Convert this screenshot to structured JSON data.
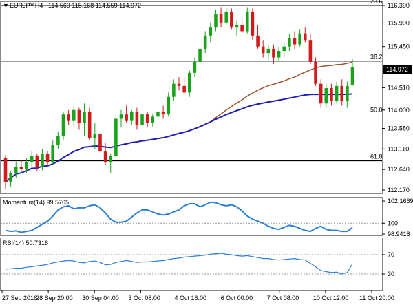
{
  "header": {
    "symbol": "EURJPY,H4",
    "ohlc": "114.569 115.168 114.559 114.972"
  },
  "main_panel": {
    "price_ticks": [
      "116.390",
      "115.990",
      "115.450",
      "114.510",
      "114.000",
      "113.580",
      "113.110",
      "112.640",
      "112.170"
    ],
    "current_price": "114.972",
    "fib_levels": [
      {
        "label": "23.6",
        "price": 116.39
      },
      {
        "label": "38.2",
        "price": 115.12
      },
      {
        "label": "50.0",
        "price": 113.91
      },
      {
        "label": "61.8",
        "price": 112.84
      }
    ]
  },
  "momentum_panel": {
    "title": "Momentum(14) 99.5765",
    "ticks": [
      "102.1669",
      "100",
      "98.9418"
    ]
  },
  "rsi_panel": {
    "title": "RSI(14) 50.7318",
    "ticks": [
      "70",
      "30"
    ]
  },
  "time_labels": [
    "27 Sep 2016",
    "28 Sep 20:00",
    "30 Sep 04:00",
    "3 Oct 08:00",
    "4 Oct 16:00",
    "6 Oct 00:00",
    "7 Oct 08:00",
    "10 Oct 12:00",
    "11 Oct 20:00"
  ],
  "colors": {
    "bull": "#1aa31a",
    "bear": "#d11a1a",
    "sma100": "#a0522d",
    "sma200": "#1f1fb3",
    "momentum": "#2b7fd4",
    "rsi": "#2b7fd4",
    "level": "#000000"
  },
  "chart_data": [
    {
      "type": "candlestick",
      "name": "EURJPY,H4",
      "ylim": [
        112.17,
        116.39
      ],
      "candles": [
        [
          112.9,
          112.97,
          112.2,
          112.35
        ],
        [
          112.35,
          112.6,
          112.25,
          112.55
        ],
        [
          112.55,
          112.8,
          112.45,
          112.7
        ],
        [
          112.7,
          112.85,
          112.6,
          112.65
        ],
        [
          112.65,
          112.9,
          112.55,
          112.8
        ],
        [
          112.8,
          113.05,
          112.7,
          112.95
        ],
        [
          112.95,
          113.0,
          112.6,
          112.7
        ],
        [
          112.7,
          113.1,
          112.62,
          113.0
        ],
        [
          113.0,
          113.05,
          112.72,
          112.8
        ],
        [
          112.8,
          113.3,
          112.75,
          113.2
        ],
        [
          113.2,
          113.5,
          113.1,
          113.4
        ],
        [
          113.4,
          113.95,
          113.3,
          113.9
        ],
        [
          113.9,
          114.0,
          113.65,
          113.75
        ],
        [
          113.75,
          114.1,
          113.6,
          114.0
        ],
        [
          114.0,
          114.05,
          113.55,
          113.7
        ],
        [
          113.7,
          114.15,
          113.4,
          113.95
        ],
        [
          113.95,
          114.05,
          113.3,
          113.35
        ],
        [
          113.35,
          113.7,
          113.1,
          113.45
        ],
        [
          113.45,
          113.55,
          112.95,
          113.05
        ],
        [
          113.05,
          113.25,
          112.75,
          112.8
        ],
        [
          112.8,
          113.0,
          112.55,
          112.95
        ],
        [
          112.95,
          113.9,
          112.9,
          113.8
        ],
        [
          113.8,
          114.0,
          113.6,
          113.9
        ],
        [
          113.9,
          114.1,
          113.7,
          113.75
        ],
        [
          113.75,
          114.0,
          113.65,
          113.95
        ],
        [
          113.95,
          114.05,
          113.55,
          113.65
        ],
        [
          113.65,
          114.0,
          113.55,
          113.9
        ],
        [
          113.9,
          113.95,
          113.6,
          113.7
        ],
        [
          113.7,
          113.92,
          113.62,
          113.85
        ],
        [
          113.85,
          114.0,
          113.7,
          113.95
        ],
        [
          113.95,
          114.1,
          113.8,
          113.9
        ],
        [
          113.9,
          114.4,
          113.85,
          114.3
        ],
        [
          114.3,
          114.7,
          114.2,
          114.6
        ],
        [
          114.6,
          114.75,
          114.45,
          114.55
        ],
        [
          114.55,
          114.75,
          114.35,
          114.4
        ],
        [
          114.4,
          114.9,
          114.3,
          114.85
        ],
        [
          114.85,
          115.2,
          114.75,
          115.1
        ],
        [
          115.1,
          115.5,
          115.0,
          115.4
        ],
        [
          115.4,
          115.8,
          115.3,
          115.7
        ],
        [
          115.7,
          116.0,
          115.55,
          115.9
        ],
        [
          115.9,
          116.3,
          115.8,
          116.2
        ],
        [
          116.2,
          116.35,
          115.9,
          116.0
        ],
        [
          116.0,
          116.35,
          115.95,
          116.25
        ],
        [
          116.25,
          116.32,
          115.85,
          115.9
        ],
        [
          115.9,
          116.05,
          115.7,
          115.95
        ],
        [
          115.95,
          116.1,
          115.75,
          115.8
        ],
        [
          115.8,
          116.35,
          115.75,
          116.25
        ],
        [
          116.25,
          116.32,
          115.6,
          115.7
        ],
        [
          115.7,
          115.95,
          115.4,
          115.45
        ],
        [
          115.45,
          115.6,
          115.2,
          115.3
        ],
        [
          115.3,
          115.5,
          115.15,
          115.4
        ],
        [
          115.4,
          115.5,
          115.05,
          115.2
        ],
        [
          115.2,
          115.45,
          115.1,
          115.35
        ],
        [
          115.35,
          115.55,
          115.2,
          115.45
        ],
        [
          115.45,
          115.75,
          115.35,
          115.65
        ],
        [
          115.65,
          115.8,
          115.4,
          115.5
        ],
        [
          115.5,
          115.85,
          115.45,
          115.75
        ],
        [
          115.75,
          115.9,
          115.55,
          115.6
        ],
        [
          115.6,
          115.75,
          115.05,
          115.1
        ],
        [
          115.1,
          115.2,
          114.55,
          114.6
        ],
        [
          114.6,
          114.7,
          114.05,
          114.15
        ],
        [
          114.15,
          114.6,
          114.05,
          114.5
        ],
        [
          114.5,
          114.6,
          114.1,
          114.2
        ],
        [
          114.2,
          114.65,
          114.15,
          114.55
        ],
        [
          114.55,
          114.7,
          114.1,
          114.2
        ],
        [
          114.2,
          114.65,
          114.05,
          114.55
        ],
        [
          114.569,
          115.168,
          114.559,
          114.972
        ]
      ]
    },
    {
      "type": "line",
      "name": "Momentum(14)",
      "ylim": [
        98.9418,
        102.1669
      ],
      "values": [
        99.3,
        99.2,
        99.25,
        99.1,
        99.2,
        99.3,
        99.6,
        99.9,
        100.2,
        100.7,
        101.3,
        101.6,
        101.7,
        101.4,
        101.5,
        101.5,
        101.7,
        101.8,
        101.5,
        101.0,
        100.4,
        100.1,
        100.1,
        100.2,
        100.6,
        101.0,
        101.3,
        101.3,
        101.1,
        100.9,
        100.8,
        100.9,
        101.1,
        101.3,
        101.7,
        101.9,
        101.9,
        101.6,
        101.8,
        102.05,
        102.0,
        101.8,
        101.7,
        101.8,
        101.6,
        101.2,
        100.7,
        100.4,
        100.2,
        100.0,
        99.7,
        99.5,
        99.4,
        99.6,
        99.8,
        99.7,
        99.5,
        99.3,
        99.2,
        99.5,
        99.7,
        99.4,
        99.3,
        99.3,
        99.2,
        99.2,
        99.5765
      ]
    },
    {
      "type": "line",
      "name": "RSI(14)",
      "ylim": [
        0,
        100
      ],
      "values": [
        40,
        41,
        42,
        42,
        44,
        45,
        47,
        48,
        50,
        53,
        55,
        57,
        58,
        57,
        54,
        53,
        56,
        57,
        54,
        49,
        50,
        54,
        56,
        58,
        56,
        54,
        55,
        55,
        56,
        57,
        58,
        60,
        62,
        63,
        65,
        66,
        67,
        68,
        69,
        71,
        72,
        73,
        71,
        70,
        68,
        67,
        68,
        66,
        64,
        62,
        62,
        60,
        59,
        60,
        61,
        62,
        60,
        59,
        52,
        45,
        37,
        35,
        33,
        34,
        30,
        33,
        50.7318
      ]
    }
  ]
}
